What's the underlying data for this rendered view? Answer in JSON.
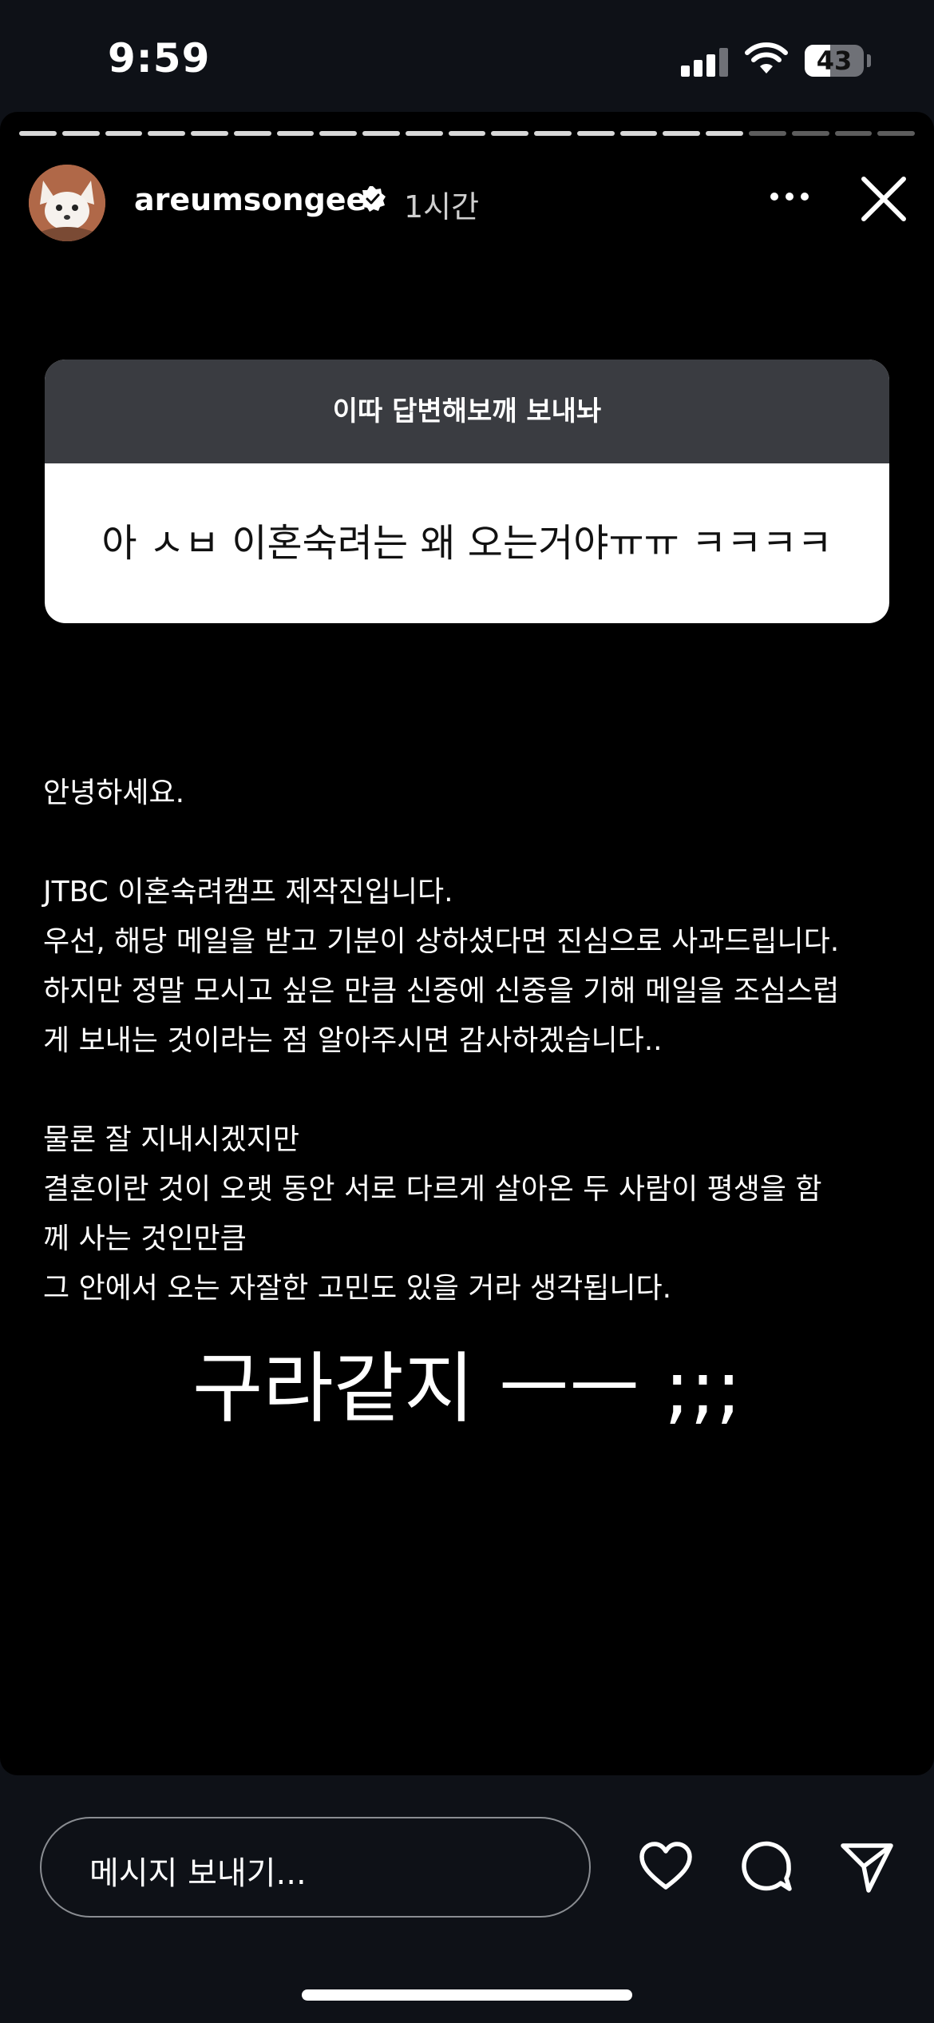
{
  "status_bar": {
    "time": "9:59",
    "battery": "43",
    "battery_level": 0.43
  },
  "story": {
    "progress": {
      "total": 21,
      "current": 17
    },
    "header": {
      "username": "areumsongee",
      "time_ago": "1시간"
    },
    "question": {
      "title": "이따 답변해보깨 보내놔",
      "answer": "아 ㅅㅂ 이혼숙려는 왜 오는거야ㅠㅠ ㅋㅋㅋㅋ"
    },
    "body": [
      "안녕하세요.",
      "",
      "JTBC 이혼숙려캠프 제작진입니다.",
      "우선, 해당 메일을 받고 기분이 상하셨다면 진심으로 사과드립니다.",
      "하지만 정말 모시고 싶은 만큼 신중에 신중을 기해 메일을 조심스럽",
      "게 보내는 것이라는 점 알아주시면 감사하겠습니다..",
      "",
      "물론 잘 지내시겠지만",
      "결혼이란 것이 오랫 동안 서로 다르게 살아온 두 사람이 평생을 함",
      "께 사는 것인만큼",
      "그 안에서 오는 자잘한 고민도 있을 거라 생각됩니다."
    ],
    "caption": "구라같지 ㅡㅡ ;;;"
  },
  "bottom_bar": {
    "message_placeholder": "메시지 보내기...",
    "icons": [
      "heart-icon",
      "comment-icon",
      "send-icon"
    ]
  }
}
